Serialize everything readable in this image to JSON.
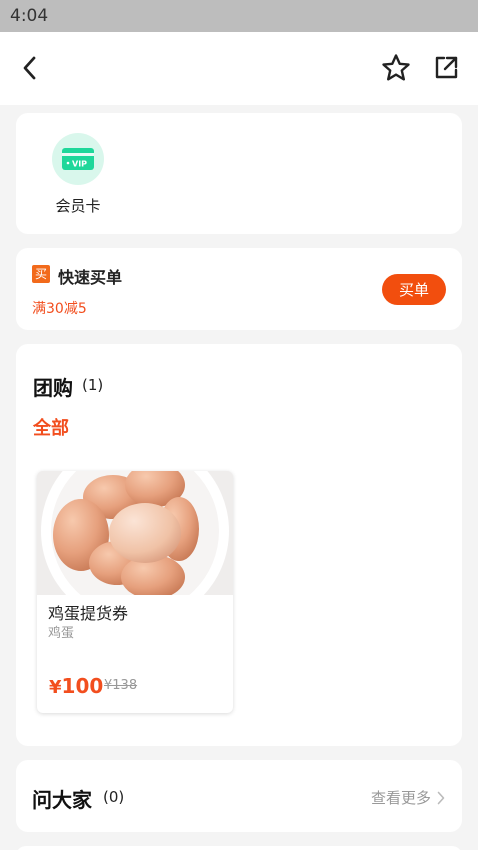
{
  "status_bar": {
    "time": "4:04"
  },
  "nav": {
    "back_icon": "chevron-left-icon",
    "favorite_icon": "star-icon",
    "share_icon": "share-icon"
  },
  "membership": {
    "label": "会员卡",
    "icon": "vip-card-icon",
    "icon_text": "VIP",
    "accent": "#1fd79a"
  },
  "quick_pay": {
    "tag": "买",
    "title": "快速买单",
    "discount": "满30减5",
    "button_label": "买单",
    "accent": "#f24e0e"
  },
  "group_buy": {
    "title": "团购",
    "count": "(1)",
    "filter_label": "全部",
    "deals": [
      {
        "name": "鸡蛋提货券",
        "subtitle": "鸡蛋",
        "currency": "¥",
        "price": "100",
        "original_price": "¥138"
      }
    ]
  },
  "qa": {
    "title": "问大家",
    "count": "(0)",
    "more_label": "查看更多"
  }
}
